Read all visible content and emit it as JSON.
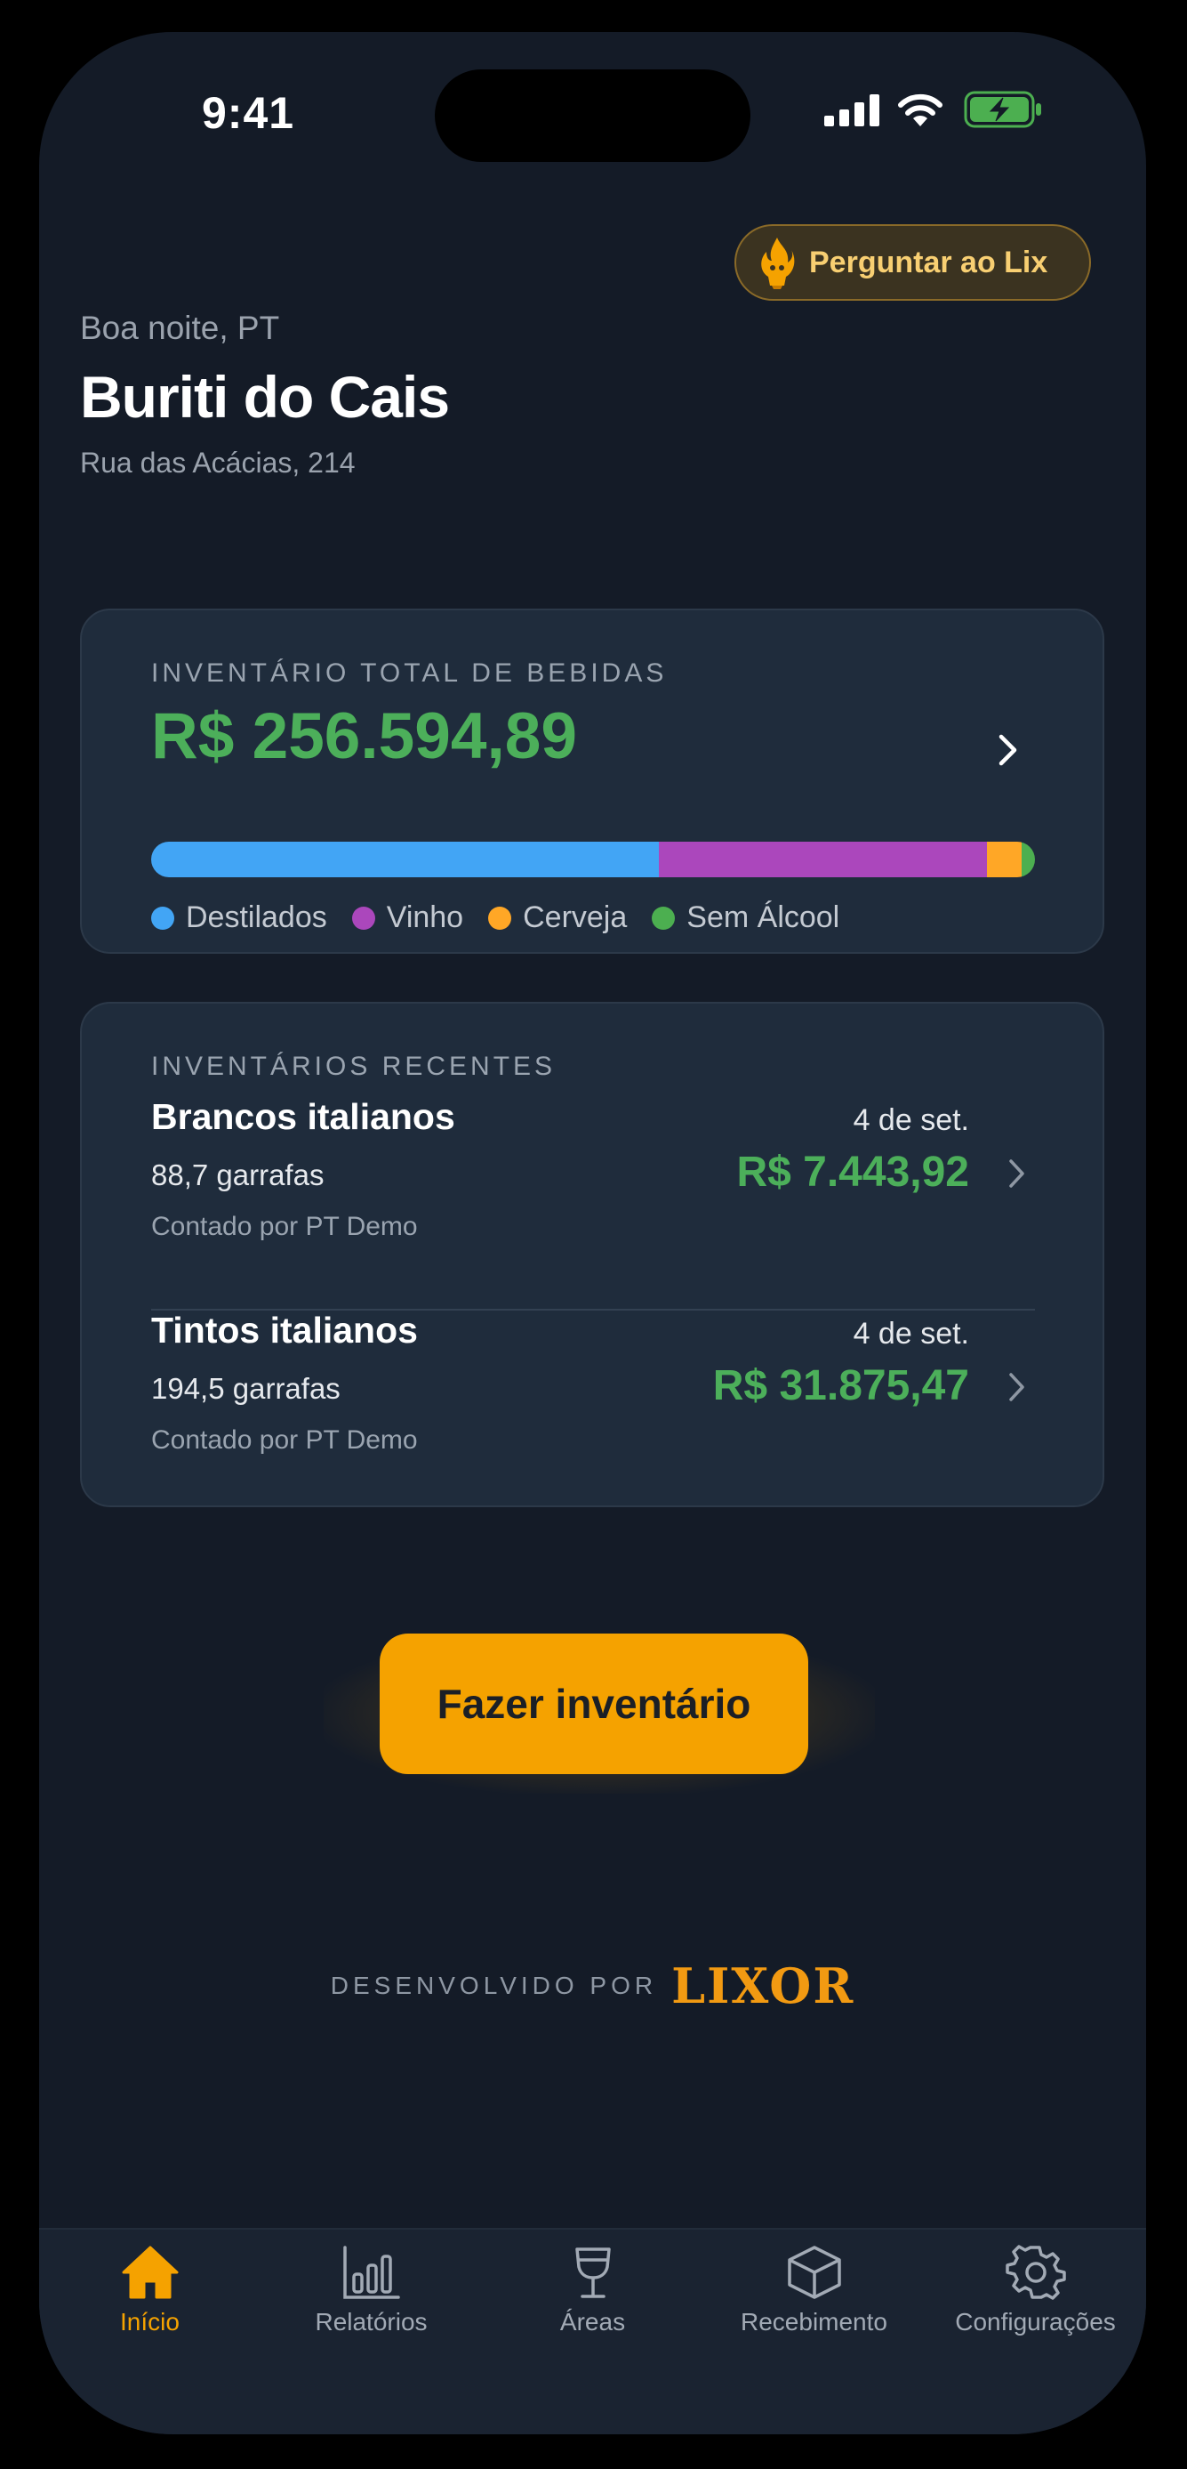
{
  "status_bar": {
    "time": "9:41"
  },
  "header": {
    "ask_label": "Perguntar ao Lix",
    "greeting": "Boa noite, PT",
    "venue_name": "Buriti do Cais",
    "address": "Rua das Acácias, 214"
  },
  "inventory_total": {
    "caption": "INVENTÁRIO TOTAL DE BEBIDAS",
    "value": "R$ 256.594,89",
    "breakdown": [
      {
        "label": "Destilados",
        "fraction": 0.574,
        "color": "#42a5f5"
      },
      {
        "label": "Vinho",
        "fraction": 0.372,
        "color": "#ab47bc"
      },
      {
        "label": "Cerveja",
        "fraction": 0.039,
        "color": "#ffa726"
      },
      {
        "label": "Sem Álcool",
        "fraction": 0.015,
        "color": "#4caf50"
      }
    ]
  },
  "recent": {
    "caption": "INVENTÁRIOS RECENTES",
    "items": [
      {
        "name": "Brancos italianos",
        "date": "4 de set.",
        "qty": "88,7 garrafas",
        "value": "R$ 7.443,92",
        "counted_by": "Contado por PT Demo"
      },
      {
        "name": "Tintos italianos",
        "date": "4 de set.",
        "qty": "194,5 garrafas",
        "value": "R$ 31.875,47",
        "counted_by": "Contado por PT Demo"
      }
    ]
  },
  "cta": {
    "label": "Fazer inventário"
  },
  "footer": {
    "credit": "DESENVOLVIDO POR",
    "brand": "LIXOR"
  },
  "tabbar": {
    "active": "Início",
    "items": [
      {
        "label": "Início",
        "icon": "home-icon"
      },
      {
        "label": "Relatórios",
        "icon": "bar-chart-icon"
      },
      {
        "label": "Áreas",
        "icon": "wine-glass-icon"
      },
      {
        "label": "Recebimento",
        "icon": "box-icon"
      },
      {
        "label": "Configurações",
        "icon": "gear-icon"
      }
    ]
  },
  "colors": {
    "accent": "#f5a200",
    "positive": "#4caf5a",
    "background": "#141b27",
    "card": "#1f2c3c"
  }
}
